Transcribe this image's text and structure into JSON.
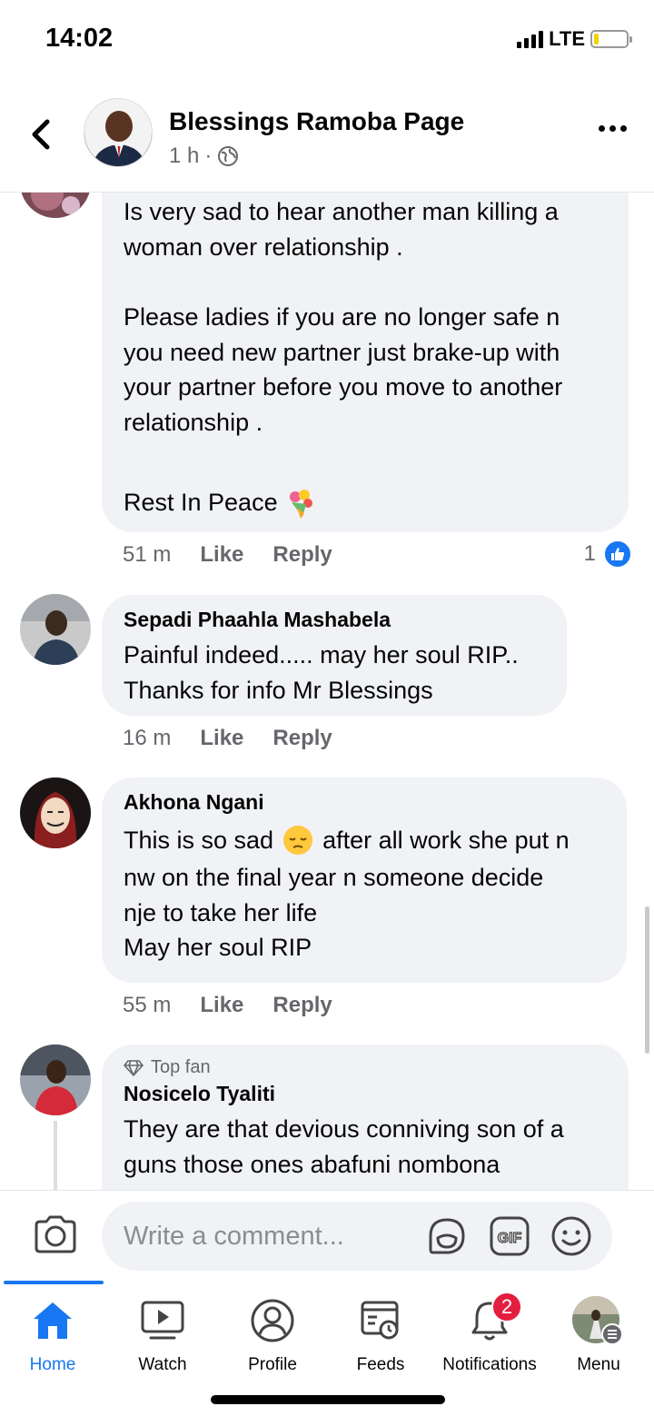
{
  "status": {
    "time": "14:02",
    "network": "LTE"
  },
  "header": {
    "title": "Blessings Ramoba Page",
    "time": "1 h",
    "separator": "·"
  },
  "comments": [
    {
      "lines": [
        "Is very sad to hear another man killing a",
        "woman over relationship .",
        "",
        "Please ladies if you are no longer safe n",
        "you need new partner just brake-up with",
        "your partner before you move to another",
        "relationship .",
        "",
        "Rest In Peace"
      ],
      "emoji": "bouquet",
      "time": "51 m",
      "like": "Like",
      "reply": "Reply",
      "reaction_count": "1"
    },
    {
      "name": "Sepadi Phaahla Mashabela",
      "lines": [
        "Painful indeed..... may her soul RIP..",
        "Thanks for info Mr Blessings"
      ],
      "time": "16 m",
      "like": "Like",
      "reply": "Reply"
    },
    {
      "name": "Akhona Ngani",
      "line1_a": "This is so sad",
      "line1_b": "after all work she put n",
      "lines": [
        "nw on the final year n someone decide",
        "nje to take her life",
        "May her soul RIP"
      ],
      "emoji": "pensive-face",
      "time": "55 m",
      "like": "Like",
      "reply": "Reply"
    },
    {
      "badge": "Top fan",
      "name": "Nosicelo Tyaliti",
      "lines": [
        "They are that devious conniving son of a",
        "guns those ones abafuni nombona"
      ]
    }
  ],
  "composer": {
    "placeholder": "Write a comment..."
  },
  "tabs": [
    {
      "label": "Home",
      "icon": "home-icon",
      "active": true
    },
    {
      "label": "Watch",
      "icon": "watch-icon"
    },
    {
      "label": "Profile",
      "icon": "profile-icon"
    },
    {
      "label": "Feeds",
      "icon": "feeds-icon"
    },
    {
      "label": "Notifications",
      "icon": "bell-icon",
      "badge": "2"
    },
    {
      "label": "Menu",
      "icon": "menu-avatar-icon"
    }
  ],
  "colors": {
    "accent": "#1877f2",
    "bubble": "#f0f2f5",
    "muted": "#65676b",
    "badge": "#e41e3f"
  }
}
